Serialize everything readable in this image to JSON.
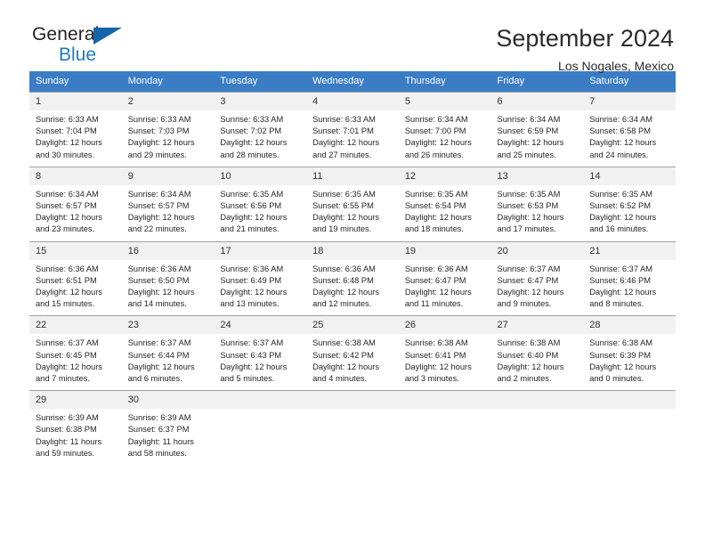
{
  "brand": {
    "name_top": "General",
    "name_bottom": "Blue",
    "accent_color": "#1f7ac4",
    "triangle_color": "#1565a8"
  },
  "header": {
    "title": "September 2024",
    "subtitle": "Los Nogales, Mexico"
  },
  "calendar": {
    "header_bg": "#3b7dc4",
    "daynum_bg": "#f1f1f1",
    "weekdays": [
      "Sunday",
      "Monday",
      "Tuesday",
      "Wednesday",
      "Thursday",
      "Friday",
      "Saturday"
    ],
    "weeks": [
      [
        {
          "day": "1",
          "sunrise": "Sunrise: 6:33 AM",
          "sunset": "Sunset: 7:04 PM",
          "daylight_1": "Daylight: 12 hours",
          "daylight_2": "and 30 minutes."
        },
        {
          "day": "2",
          "sunrise": "Sunrise: 6:33 AM",
          "sunset": "Sunset: 7:03 PM",
          "daylight_1": "Daylight: 12 hours",
          "daylight_2": "and 29 minutes."
        },
        {
          "day": "3",
          "sunrise": "Sunrise: 6:33 AM",
          "sunset": "Sunset: 7:02 PM",
          "daylight_1": "Daylight: 12 hours",
          "daylight_2": "and 28 minutes."
        },
        {
          "day": "4",
          "sunrise": "Sunrise: 6:33 AM",
          "sunset": "Sunset: 7:01 PM",
          "daylight_1": "Daylight: 12 hours",
          "daylight_2": "and 27 minutes."
        },
        {
          "day": "5",
          "sunrise": "Sunrise: 6:34 AM",
          "sunset": "Sunset: 7:00 PM",
          "daylight_1": "Daylight: 12 hours",
          "daylight_2": "and 26 minutes."
        },
        {
          "day": "6",
          "sunrise": "Sunrise: 6:34 AM",
          "sunset": "Sunset: 6:59 PM",
          "daylight_1": "Daylight: 12 hours",
          "daylight_2": "and 25 minutes."
        },
        {
          "day": "7",
          "sunrise": "Sunrise: 6:34 AM",
          "sunset": "Sunset: 6:58 PM",
          "daylight_1": "Daylight: 12 hours",
          "daylight_2": "and 24 minutes."
        }
      ],
      [
        {
          "day": "8",
          "sunrise": "Sunrise: 6:34 AM",
          "sunset": "Sunset: 6:57 PM",
          "daylight_1": "Daylight: 12 hours",
          "daylight_2": "and 23 minutes."
        },
        {
          "day": "9",
          "sunrise": "Sunrise: 6:34 AM",
          "sunset": "Sunset: 6:57 PM",
          "daylight_1": "Daylight: 12 hours",
          "daylight_2": "and 22 minutes."
        },
        {
          "day": "10",
          "sunrise": "Sunrise: 6:35 AM",
          "sunset": "Sunset: 6:56 PM",
          "daylight_1": "Daylight: 12 hours",
          "daylight_2": "and 21 minutes."
        },
        {
          "day": "11",
          "sunrise": "Sunrise: 6:35 AM",
          "sunset": "Sunset: 6:55 PM",
          "daylight_1": "Daylight: 12 hours",
          "daylight_2": "and 19 minutes."
        },
        {
          "day": "12",
          "sunrise": "Sunrise: 6:35 AM",
          "sunset": "Sunset: 6:54 PM",
          "daylight_1": "Daylight: 12 hours",
          "daylight_2": "and 18 minutes."
        },
        {
          "day": "13",
          "sunrise": "Sunrise: 6:35 AM",
          "sunset": "Sunset: 6:53 PM",
          "daylight_1": "Daylight: 12 hours",
          "daylight_2": "and 17 minutes."
        },
        {
          "day": "14",
          "sunrise": "Sunrise: 6:35 AM",
          "sunset": "Sunset: 6:52 PM",
          "daylight_1": "Daylight: 12 hours",
          "daylight_2": "and 16 minutes."
        }
      ],
      [
        {
          "day": "15",
          "sunrise": "Sunrise: 6:36 AM",
          "sunset": "Sunset: 6:51 PM",
          "daylight_1": "Daylight: 12 hours",
          "daylight_2": "and 15 minutes."
        },
        {
          "day": "16",
          "sunrise": "Sunrise: 6:36 AM",
          "sunset": "Sunset: 6:50 PM",
          "daylight_1": "Daylight: 12 hours",
          "daylight_2": "and 14 minutes."
        },
        {
          "day": "17",
          "sunrise": "Sunrise: 6:36 AM",
          "sunset": "Sunset: 6:49 PM",
          "daylight_1": "Daylight: 12 hours",
          "daylight_2": "and 13 minutes."
        },
        {
          "day": "18",
          "sunrise": "Sunrise: 6:36 AM",
          "sunset": "Sunset: 6:48 PM",
          "daylight_1": "Daylight: 12 hours",
          "daylight_2": "and 12 minutes."
        },
        {
          "day": "19",
          "sunrise": "Sunrise: 6:36 AM",
          "sunset": "Sunset: 6:47 PM",
          "daylight_1": "Daylight: 12 hours",
          "daylight_2": "and 11 minutes."
        },
        {
          "day": "20",
          "sunrise": "Sunrise: 6:37 AM",
          "sunset": "Sunset: 6:47 PM",
          "daylight_1": "Daylight: 12 hours",
          "daylight_2": "and 9 minutes."
        },
        {
          "day": "21",
          "sunrise": "Sunrise: 6:37 AM",
          "sunset": "Sunset: 6:46 PM",
          "daylight_1": "Daylight: 12 hours",
          "daylight_2": "and 8 minutes."
        }
      ],
      [
        {
          "day": "22",
          "sunrise": "Sunrise: 6:37 AM",
          "sunset": "Sunset: 6:45 PM",
          "daylight_1": "Daylight: 12 hours",
          "daylight_2": "and 7 minutes."
        },
        {
          "day": "23",
          "sunrise": "Sunrise: 6:37 AM",
          "sunset": "Sunset: 6:44 PM",
          "daylight_1": "Daylight: 12 hours",
          "daylight_2": "and 6 minutes."
        },
        {
          "day": "24",
          "sunrise": "Sunrise: 6:37 AM",
          "sunset": "Sunset: 6:43 PM",
          "daylight_1": "Daylight: 12 hours",
          "daylight_2": "and 5 minutes."
        },
        {
          "day": "25",
          "sunrise": "Sunrise: 6:38 AM",
          "sunset": "Sunset: 6:42 PM",
          "daylight_1": "Daylight: 12 hours",
          "daylight_2": "and 4 minutes."
        },
        {
          "day": "26",
          "sunrise": "Sunrise: 6:38 AM",
          "sunset": "Sunset: 6:41 PM",
          "daylight_1": "Daylight: 12 hours",
          "daylight_2": "and 3 minutes."
        },
        {
          "day": "27",
          "sunrise": "Sunrise: 6:38 AM",
          "sunset": "Sunset: 6:40 PM",
          "daylight_1": "Daylight: 12 hours",
          "daylight_2": "and 2 minutes."
        },
        {
          "day": "28",
          "sunrise": "Sunrise: 6:38 AM",
          "sunset": "Sunset: 6:39 PM",
          "daylight_1": "Daylight: 12 hours",
          "daylight_2": "and 0 minutes."
        }
      ],
      [
        {
          "day": "29",
          "sunrise": "Sunrise: 6:39 AM",
          "sunset": "Sunset: 6:38 PM",
          "daylight_1": "Daylight: 11 hours",
          "daylight_2": "and 59 minutes."
        },
        {
          "day": "30",
          "sunrise": "Sunrise: 6:39 AM",
          "sunset": "Sunset: 6:37 PM",
          "daylight_1": "Daylight: 11 hours",
          "daylight_2": "and 58 minutes."
        },
        {
          "day": "",
          "sunrise": "",
          "sunset": "",
          "daylight_1": "",
          "daylight_2": ""
        },
        {
          "day": "",
          "sunrise": "",
          "sunset": "",
          "daylight_1": "",
          "daylight_2": ""
        },
        {
          "day": "",
          "sunrise": "",
          "sunset": "",
          "daylight_1": "",
          "daylight_2": ""
        },
        {
          "day": "",
          "sunrise": "",
          "sunset": "",
          "daylight_1": "",
          "daylight_2": ""
        },
        {
          "day": "",
          "sunrise": "",
          "sunset": "",
          "daylight_1": "",
          "daylight_2": ""
        }
      ]
    ]
  }
}
